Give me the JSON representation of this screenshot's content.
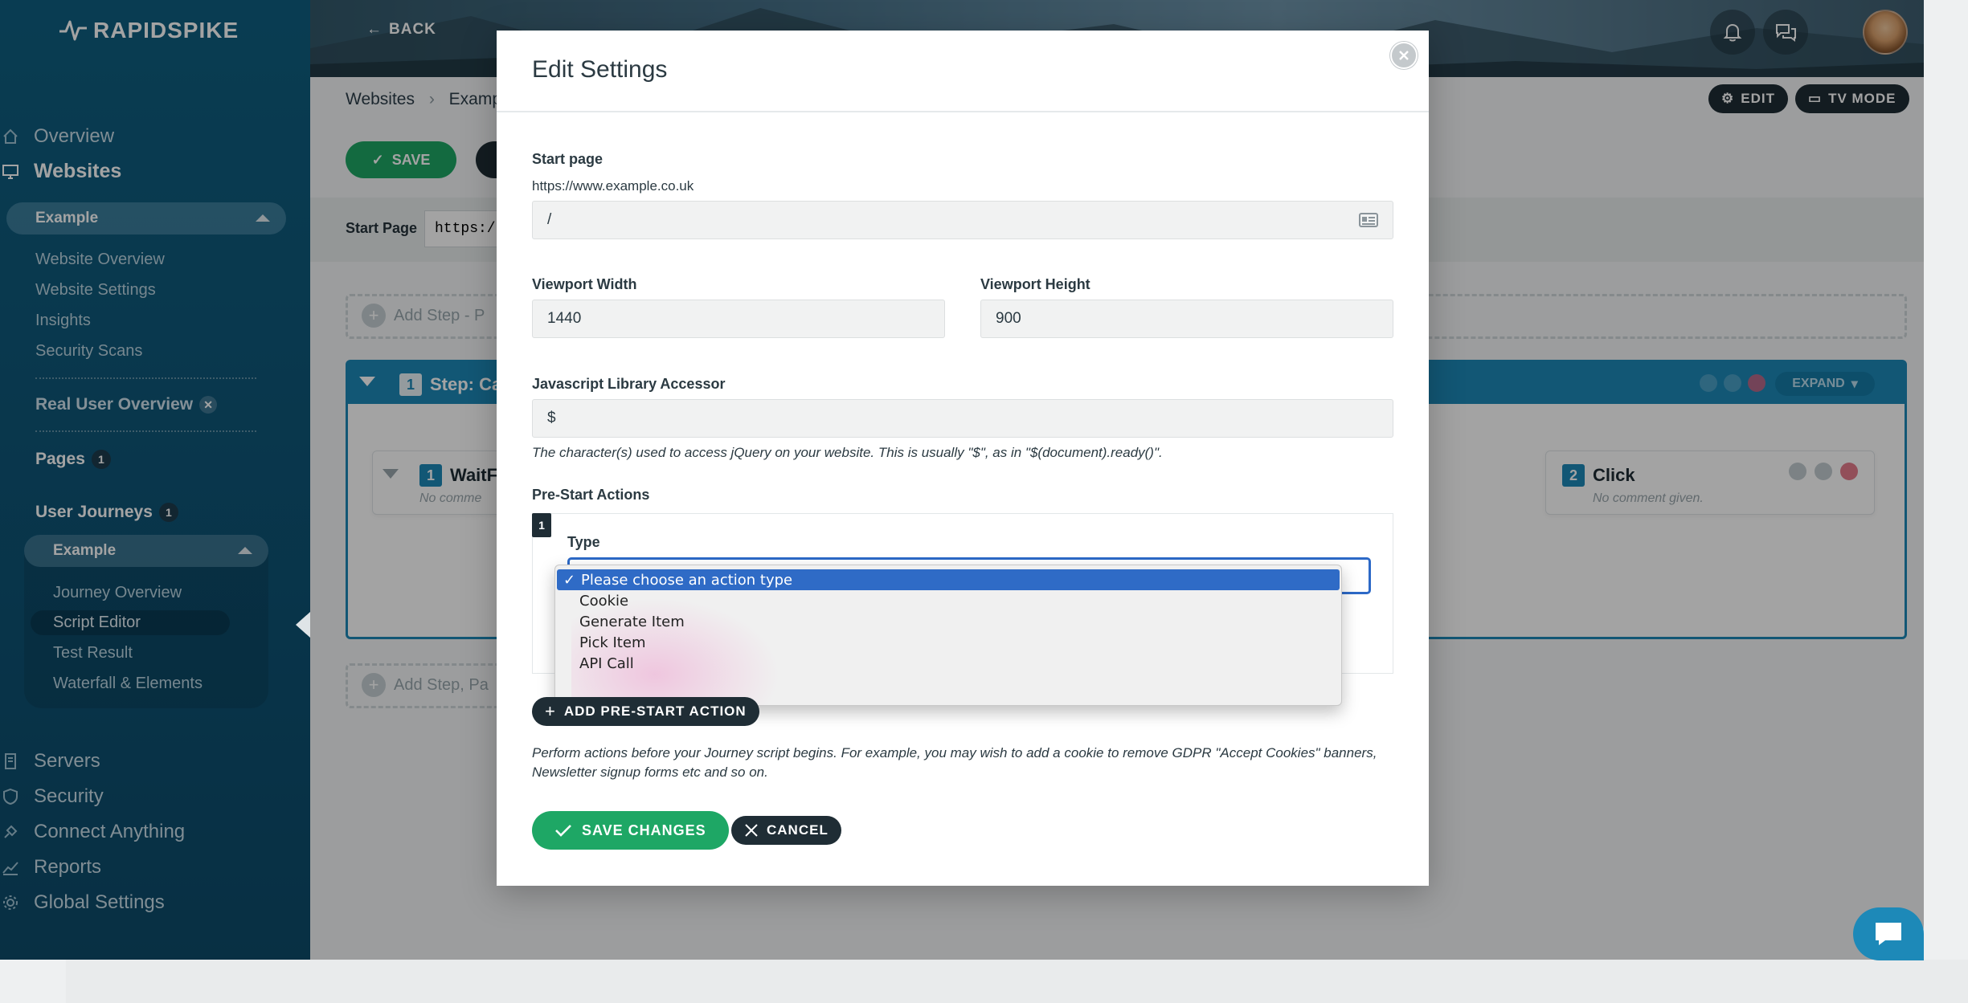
{
  "brand": {
    "name": "RAPIDSPIKE"
  },
  "header": {
    "back_label": "BACK"
  },
  "sidebar": {
    "nav_top": [
      {
        "label": "Overview",
        "icon": "home-icon"
      },
      {
        "label": "Websites",
        "icon": "monitor-icon"
      }
    ],
    "website_pill": "Example",
    "website_links": [
      "Website Overview",
      "Website Settings",
      "Insights",
      "Security Scans"
    ],
    "rum": "Real User Overview",
    "pages": {
      "label": "Pages",
      "count": "1"
    },
    "journeys": {
      "label": "User Journeys",
      "count": "1"
    },
    "journey_pill": "Example",
    "journey_links": [
      "Journey Overview",
      "Script Editor",
      "Test Result",
      "Waterfall & Elements"
    ],
    "nav_bottom": [
      {
        "label": "Servers",
        "icon": "server-icon"
      },
      {
        "label": "Security",
        "icon": "shield-icon"
      },
      {
        "label": "Connect Anything",
        "icon": "plug-icon"
      },
      {
        "label": "Reports",
        "icon": "chart-icon"
      },
      {
        "label": "Global Settings",
        "icon": "gear-icon"
      }
    ]
  },
  "background": {
    "breadcrumb": [
      "Websites",
      "Exampl"
    ],
    "edit_label": "EDIT",
    "tv_label": "TV MODE",
    "save_label": "SAVE",
    "start_page_label": "Start Page",
    "start_page_value": "https:/",
    "add_step_top": "Add Step - P",
    "add_step_bottom": "Add Step, Pa",
    "step_title": "Step: Ca",
    "step_num": "1",
    "expand_label": "EXPAND",
    "card1": {
      "num": "1",
      "title": "WaitF",
      "comment": "No comme"
    },
    "card2": {
      "num": "2",
      "title": "Click",
      "comment": "No comment given."
    }
  },
  "modal": {
    "title": "Edit Settings",
    "start_page": {
      "label": "Start page",
      "base_url": "https://www.example.co.uk",
      "value": "/"
    },
    "viewport_width": {
      "label": "Viewport Width",
      "value": "1440"
    },
    "viewport_height": {
      "label": "Viewport Height",
      "value": "900"
    },
    "js_accessor": {
      "label": "Javascript Library Accessor",
      "value": "$",
      "help": "The character(s) used to access jQuery on your website. This is usually \"$\", as in \"$(document).ready()\"."
    },
    "prestart": {
      "label": "Pre-Start Actions",
      "index": "1",
      "type_label": "Type",
      "options": [
        "Please choose an action type",
        "Cookie",
        "Generate Item",
        "Pick Item",
        "API Call"
      ],
      "selected_index": 0,
      "add_label": "ADD PRE-START ACTION",
      "help": "Perform actions before your Journey script begins. For example, you may wish to add a cookie to remove GDPR \"Accept Cookies\" banners, Newsletter signup forms etc and so on."
    },
    "save_label": "SAVE CHANGES",
    "cancel_label": "CANCEL"
  },
  "colors": {
    "primary_blue": "#1d89b8",
    "green": "#1ea765",
    "dark": "#1f2d35",
    "select_blue": "#2f6bc6"
  }
}
